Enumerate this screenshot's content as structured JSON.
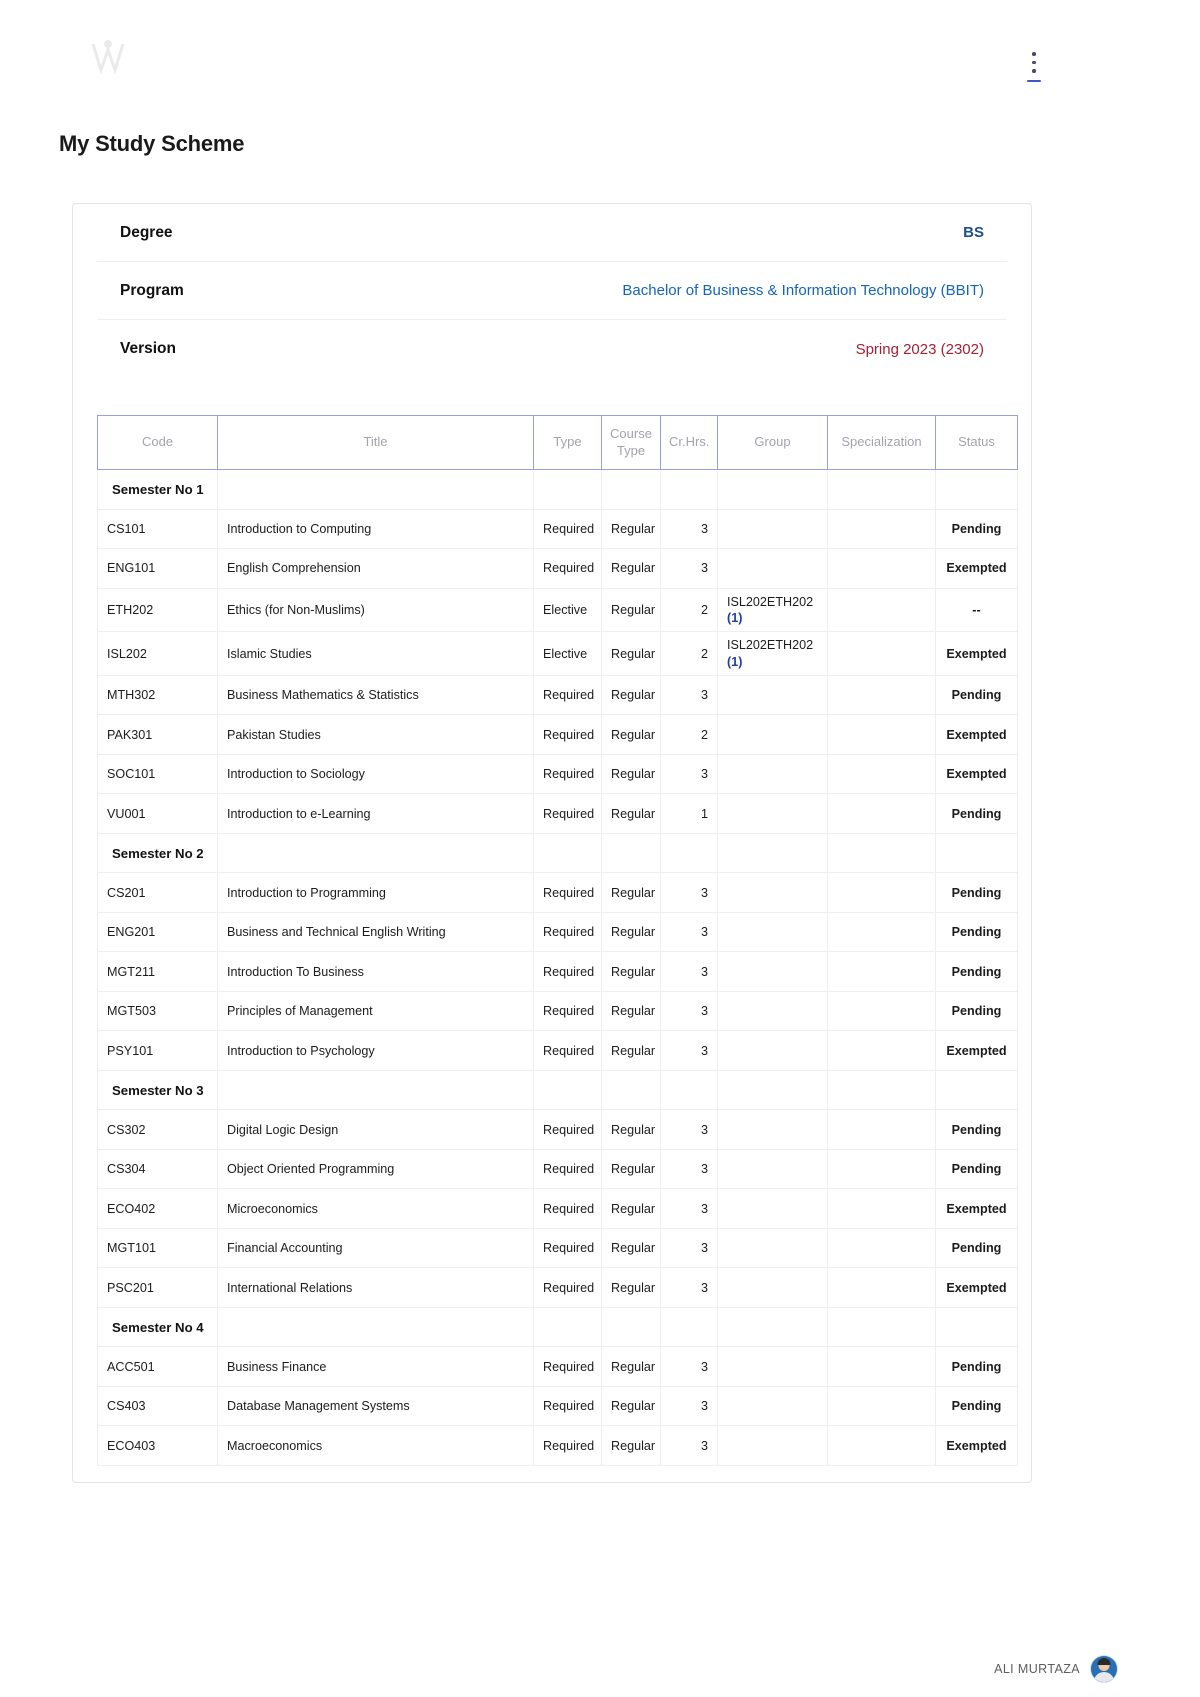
{
  "header": {
    "logo_name": "vu-logo",
    "menu_icon": "kebab-menu-icon"
  },
  "page_title": "My Study Scheme",
  "info": {
    "rows": [
      {
        "label": "Degree",
        "value": "BS",
        "style": "degree"
      },
      {
        "label": "Program",
        "value": "Bachelor of Business & Information Technology (BBIT)",
        "style": "program"
      },
      {
        "label": "Version",
        "value": "Spring 2023 (2302)",
        "style": "version"
      }
    ]
  },
  "table": {
    "columns": [
      "Code",
      "Title",
      "Type",
      "Course Type",
      "Cr.Hrs.",
      "Group",
      "Specialization",
      "Status"
    ],
    "rows": [
      {
        "kind": "semester",
        "code": "Semester No 1"
      },
      {
        "kind": "course",
        "code": "CS101",
        "title": "Introduction to Computing",
        "type": "Required",
        "course_type": "Regular",
        "hrs": "3",
        "group": "",
        "group_count": "",
        "spec": "",
        "status": "Pending",
        "status_style": "pending"
      },
      {
        "kind": "course",
        "code": "ENG101",
        "title": "English Comprehension",
        "type": "Required",
        "course_type": "Regular",
        "hrs": "3",
        "group": "",
        "group_count": "",
        "spec": "",
        "status": "Exempted",
        "status_style": "exempted"
      },
      {
        "kind": "course",
        "code": "ETH202",
        "title": "Ethics (for Non-Muslims)",
        "type": "Elective",
        "course_type": "Regular",
        "hrs": "2",
        "group": "ISL202ETH202",
        "group_count": "(1)",
        "spec": "",
        "status": "--",
        "status_style": "dash"
      },
      {
        "kind": "course",
        "code": "ISL202",
        "title": "Islamic Studies",
        "type": "Elective",
        "course_type": "Regular",
        "hrs": "2",
        "group": "ISL202ETH202",
        "group_count": "(1)",
        "spec": "",
        "status": "Exempted",
        "status_style": "exempted"
      },
      {
        "kind": "course",
        "code": "MTH302",
        "title": "Business Mathematics & Statistics",
        "type": "Required",
        "course_type": "Regular",
        "hrs": "3",
        "group": "",
        "group_count": "",
        "spec": "",
        "status": "Pending",
        "status_style": "pending"
      },
      {
        "kind": "course",
        "code": "PAK301",
        "title": "Pakistan Studies",
        "type": "Required",
        "course_type": "Regular",
        "hrs": "2",
        "group": "",
        "group_count": "",
        "spec": "",
        "status": "Exempted",
        "status_style": "exempted"
      },
      {
        "kind": "course",
        "code": "SOC101",
        "title": "Introduction to Sociology",
        "type": "Required",
        "course_type": "Regular",
        "hrs": "3",
        "group": "",
        "group_count": "",
        "spec": "",
        "status": "Exempted",
        "status_style": "exempted"
      },
      {
        "kind": "course",
        "code": "VU001",
        "title": "Introduction to e-Learning",
        "type": "Required",
        "course_type": "Regular",
        "hrs": "1",
        "group": "",
        "group_count": "",
        "spec": "",
        "status": "Pending",
        "status_style": "pending"
      },
      {
        "kind": "semester",
        "code": "Semester No 2"
      },
      {
        "kind": "course",
        "code": "CS201",
        "title": "Introduction to Programming",
        "type": "Required",
        "course_type": "Regular",
        "hrs": "3",
        "group": "",
        "group_count": "",
        "spec": "",
        "status": "Pending",
        "status_style": "pending"
      },
      {
        "kind": "course",
        "code": "ENG201",
        "title": "Business and Technical English Writing",
        "type": "Required",
        "course_type": "Regular",
        "hrs": "3",
        "group": "",
        "group_count": "",
        "spec": "",
        "status": "Pending",
        "status_style": "pending"
      },
      {
        "kind": "course",
        "code": "MGT211",
        "title": "Introduction To Business",
        "type": "Required",
        "course_type": "Regular",
        "hrs": "3",
        "group": "",
        "group_count": "",
        "spec": "",
        "status": "Pending",
        "status_style": "pending"
      },
      {
        "kind": "course",
        "code": "MGT503",
        "title": "Principles of Management",
        "type": "Required",
        "course_type": "Regular",
        "hrs": "3",
        "group": "",
        "group_count": "",
        "spec": "",
        "status": "Pending",
        "status_style": "pending"
      },
      {
        "kind": "course",
        "code": "PSY101",
        "title": "Introduction to Psychology",
        "type": "Required",
        "course_type": "Regular",
        "hrs": "3",
        "group": "",
        "group_count": "",
        "spec": "",
        "status": "Exempted",
        "status_style": "exempted"
      },
      {
        "kind": "semester",
        "code": "Semester No 3"
      },
      {
        "kind": "course",
        "code": "CS302",
        "title": "Digital Logic Design",
        "type": "Required",
        "course_type": "Regular",
        "hrs": "3",
        "group": "",
        "group_count": "",
        "spec": "",
        "status": "Pending",
        "status_style": "pending"
      },
      {
        "kind": "course",
        "code": "CS304",
        "title": "Object Oriented Programming",
        "type": "Required",
        "course_type": "Regular",
        "hrs": "3",
        "group": "",
        "group_count": "",
        "spec": "",
        "status": "Pending",
        "status_style": "pending"
      },
      {
        "kind": "course",
        "code": "ECO402",
        "title": "Microeconomics",
        "type": "Required",
        "course_type": "Regular",
        "hrs": "3",
        "group": "",
        "group_count": "",
        "spec": "",
        "status": "Exempted",
        "status_style": "exempted"
      },
      {
        "kind": "course",
        "code": "MGT101",
        "title": "Financial Accounting",
        "type": "Required",
        "course_type": "Regular",
        "hrs": "3",
        "group": "",
        "group_count": "",
        "spec": "",
        "status": "Pending",
        "status_style": "pending"
      },
      {
        "kind": "course",
        "code": "PSC201",
        "title": "International Relations",
        "type": "Required",
        "course_type": "Regular",
        "hrs": "3",
        "group": "",
        "group_count": "",
        "spec": "",
        "status": "Exempted",
        "status_style": "exempted"
      },
      {
        "kind": "semester",
        "code": "Semester No 4"
      },
      {
        "kind": "course",
        "code": "ACC501",
        "title": "Business Finance",
        "type": "Required",
        "course_type": "Regular",
        "hrs": "3",
        "group": "",
        "group_count": "",
        "spec": "",
        "status": "Pending",
        "status_style": "pending"
      },
      {
        "kind": "course",
        "code": "CS403",
        "title": "Database Management Systems",
        "type": "Required",
        "course_type": "Regular",
        "hrs": "3",
        "group": "",
        "group_count": "",
        "spec": "",
        "status": "Pending",
        "status_style": "pending"
      },
      {
        "kind": "course",
        "code": "ECO403",
        "title": "Macroeconomics",
        "type": "Required",
        "course_type": "Regular",
        "hrs": "3",
        "group": "",
        "group_count": "",
        "spec": "",
        "status": "Exempted",
        "status_style": "exempted"
      }
    ]
  },
  "footer": {
    "user_name": "ALI MURTAZA",
    "avatar_name": "user-avatar"
  },
  "colors": {
    "status_pending": "#ff0000",
    "status_exempted": "#098a09",
    "program_link": "#1565b8",
    "version": "#a61f33",
    "table_header_border": "#9b9fe0"
  }
}
